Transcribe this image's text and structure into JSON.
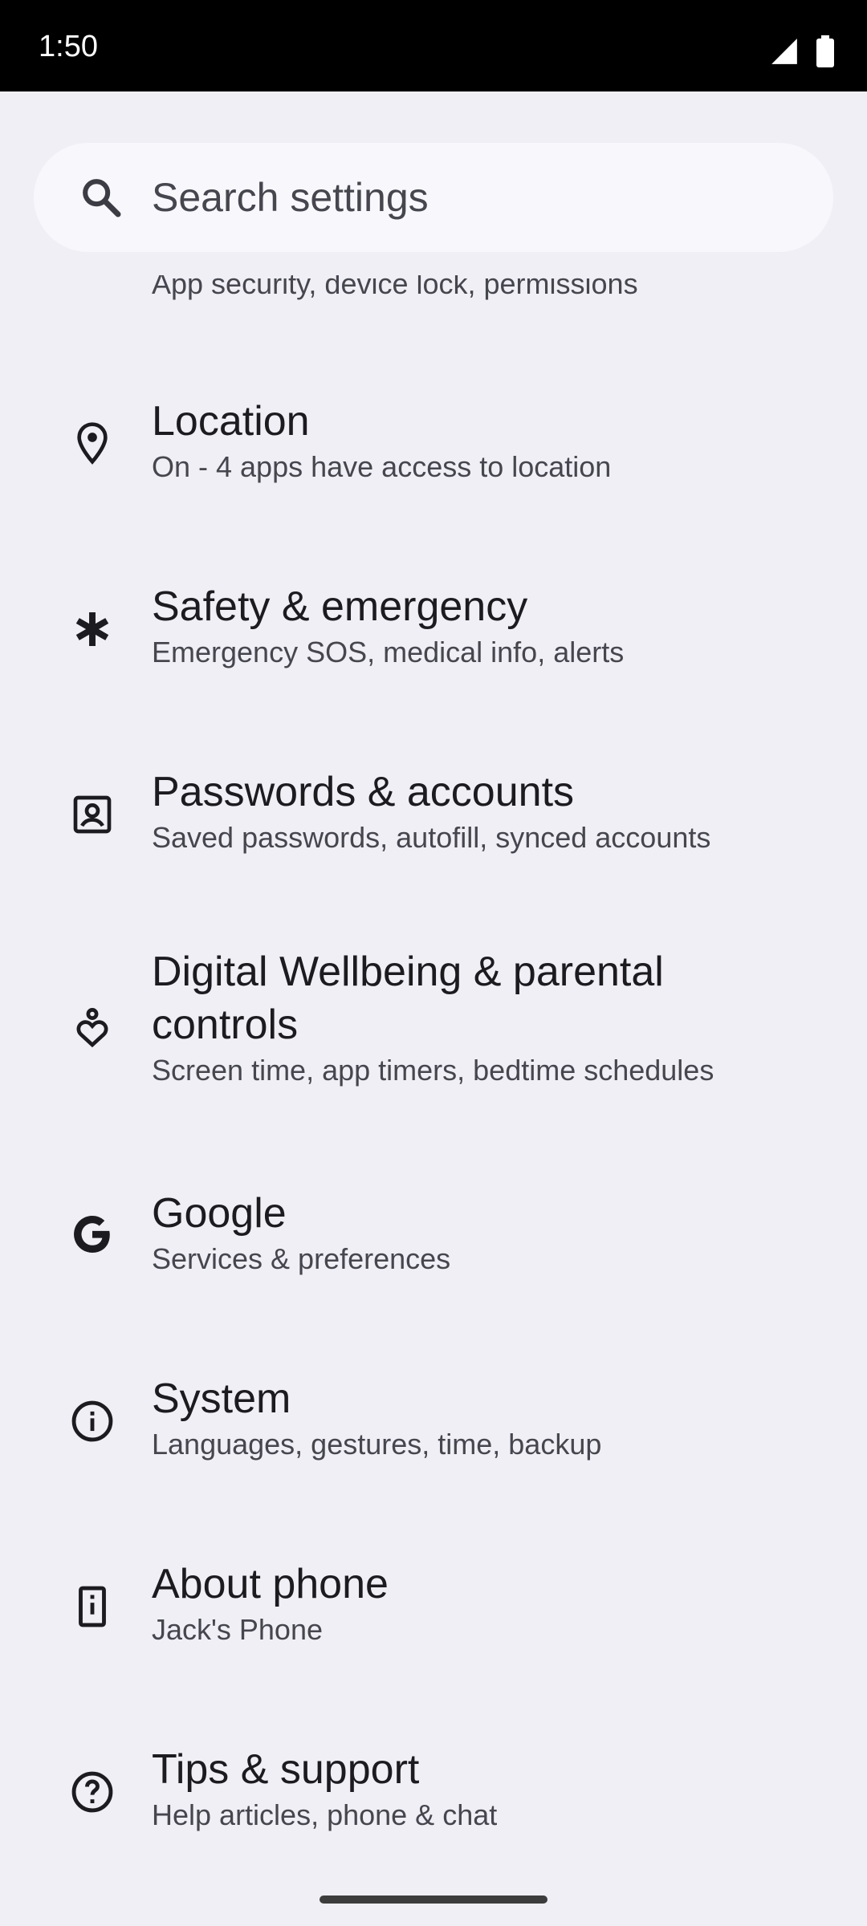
{
  "status_bar": {
    "time": "1:50",
    "icons": [
      "signal-icon",
      "battery-icon"
    ]
  },
  "search": {
    "placeholder": "Search settings",
    "icon": "search-icon"
  },
  "partial_item": {
    "subtitle": "App security, device lock, permissions"
  },
  "settings": [
    {
      "title": "Location",
      "subtitle": "On - 4 apps have access to location",
      "icon": "location-pin-icon"
    },
    {
      "title": "Safety & emergency",
      "subtitle": "Emergency SOS, medical info, alerts",
      "icon": "asterisk-icon"
    },
    {
      "title": "Passwords & accounts",
      "subtitle": "Saved passwords, autofill, synced accounts",
      "icon": "account-box-icon"
    },
    {
      "title": "Digital Wellbeing & parental controls",
      "subtitle": "Screen time, app timers, bedtime schedules",
      "icon": "wellbeing-icon"
    },
    {
      "title": "Google",
      "subtitle": "Services & preferences",
      "icon": "google-icon"
    },
    {
      "title": "System",
      "subtitle": "Languages, gestures, time, backup",
      "icon": "info-icon"
    },
    {
      "title": "About phone",
      "subtitle": "Jack's Phone",
      "icon": "phone-icon"
    },
    {
      "title": "Tips & support",
      "subtitle": "Help articles, phone & chat",
      "icon": "help-icon"
    }
  ],
  "colors": {
    "background": "#f0eff5",
    "search_background": "#f8f7fc",
    "title_text": "#1c1b1f",
    "subtitle_text": "#46464f",
    "status_bar": "#000000"
  }
}
